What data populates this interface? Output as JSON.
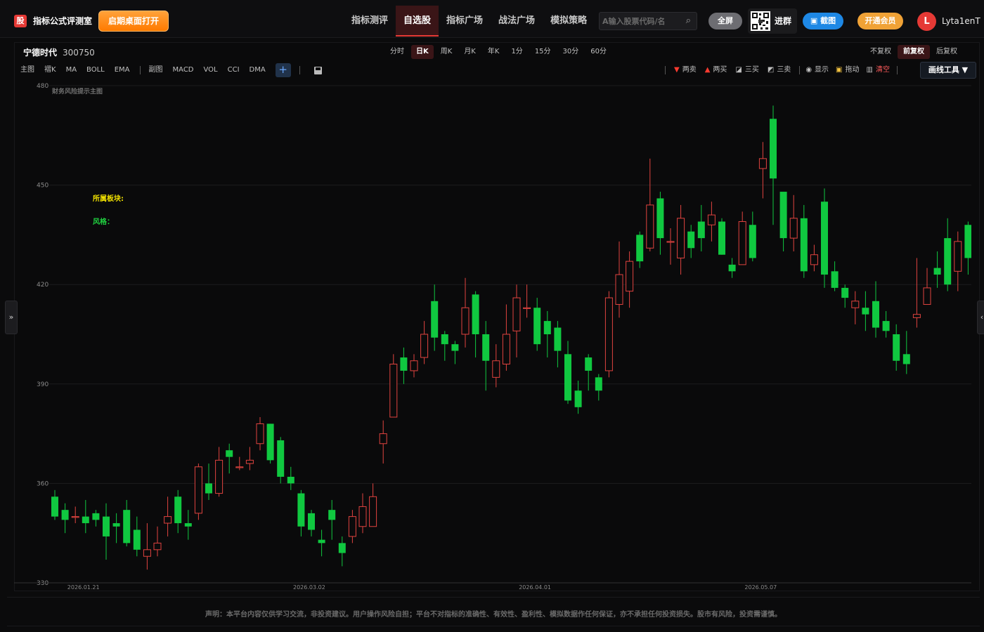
{
  "app": {
    "logo_char": "股",
    "title": "指标公式评测室",
    "open_desktop": "启期桌面打开"
  },
  "nav": {
    "items": [
      "指标测评",
      "自选股",
      "指标广场",
      "战法广场",
      "模拟策略"
    ],
    "active_index": 1
  },
  "search": {
    "placeholder": "A输入股票代码/名"
  },
  "header_actions": {
    "fullscreen": "全屏",
    "join_group": "进群",
    "screenshot": "截图",
    "vip": "开通会员",
    "avatar_letter": "L",
    "username": "Lyta1enT"
  },
  "stock": {
    "name": "宁德时代",
    "code": "300750"
  },
  "periods": {
    "items": [
      "分时",
      "日K",
      "周K",
      "月K",
      "年K",
      "1分",
      "15分",
      "30分",
      "60分"
    ],
    "active_index": 1
  },
  "adjust": {
    "items": [
      "不复权",
      "前复权",
      "后复权"
    ],
    "active_index": 1
  },
  "indicator_tools": {
    "main": [
      "主图",
      "褶K",
      "MA",
      "BOLL",
      "EMA"
    ],
    "sub": [
      "副图",
      "MACD",
      "VOL",
      "CCI",
      "DMA"
    ],
    "add": "+"
  },
  "draw_tools": {
    "items": [
      {
        "label": "两卖",
        "icon": "down-triangle-icon",
        "color": "#ff3b30"
      },
      {
        "label": "两买",
        "icon": "up-triangle-icon",
        "color": "#ff3b30"
      },
      {
        "label": "三买",
        "icon": "chart-line-icon",
        "color": "#e0e0e0"
      },
      {
        "label": "三卖",
        "icon": "chart-line-icon",
        "color": "#e0e0e0"
      },
      {
        "label": "显示",
        "icon": "eye-icon",
        "color": "#e0e0e0"
      },
      {
        "label": "拖动",
        "icon": "lock-icon",
        "color": "#e0e0e0"
      },
      {
        "label": "清空",
        "icon": "trash-icon",
        "color": "#ff5a5a"
      }
    ],
    "dropdown": "画线工具 ▼"
  },
  "side": {
    "left": "»",
    "right": "‹"
  },
  "chart_overlay": {
    "subtitle": "财务风险提示主图",
    "sector_label": "所属板块:",
    "style_label": "风格："
  },
  "colors": {
    "up": "#e0433f",
    "down": "#10c840",
    "accent": "#e53935",
    "grid": "#1c1c1e"
  },
  "chart_data": {
    "type": "candlestick",
    "ylim": [
      330,
      480
    ],
    "yticks": [
      480,
      450,
      420,
      390,
      360,
      330
    ],
    "xlabels": [
      {
        "label": "2026.01.21",
        "index": 3
      },
      {
        "label": "2026.03.02",
        "index": 25
      },
      {
        "label": "2026.04.01",
        "index": 47
      },
      {
        "label": "2026.05.07",
        "index": 69
      }
    ],
    "candles": [
      [
        356,
        350,
        358,
        349
      ],
      [
        352,
        349,
        354,
        345
      ],
      [
        350,
        350,
        353,
        348
      ],
      [
        350,
        348,
        355,
        345
      ],
      [
        351,
        349,
        352,
        347
      ],
      [
        350,
        344,
        354,
        337
      ],
      [
        348,
        347,
        351,
        342
      ],
      [
        352,
        342,
        355,
        341
      ],
      [
        346,
        340,
        350,
        338
      ],
      [
        338,
        340,
        348,
        334
      ],
      [
        340,
        342,
        347,
        338
      ],
      [
        348,
        350,
        356,
        344
      ],
      [
        356,
        348,
        358,
        345
      ],
      [
        348,
        347,
        352,
        343
      ],
      [
        351,
        365,
        366,
        349
      ],
      [
        360,
        357,
        366,
        355
      ],
      [
        357,
        367,
        371,
        356
      ],
      [
        370,
        368,
        372,
        363
      ],
      [
        365,
        365,
        368,
        364
      ],
      [
        366,
        367,
        371,
        364
      ],
      [
        372,
        378,
        380,
        370
      ],
      [
        378,
        367,
        378,
        366
      ],
      [
        373,
        362,
        374,
        360
      ],
      [
        362,
        360,
        365,
        358
      ],
      [
        357,
        347,
        358,
        344
      ],
      [
        351,
        346,
        352,
        344
      ],
      [
        343,
        342,
        346,
        338
      ],
      [
        352,
        349,
        355,
        343
      ],
      [
        342,
        339,
        344,
        335
      ],
      [
        344,
        350,
        352,
        342
      ],
      [
        347,
        353,
        357,
        345
      ],
      [
        347,
        356,
        360,
        347
      ],
      [
        372,
        375,
        379,
        366
      ],
      [
        380,
        396,
        399,
        380
      ],
      [
        398,
        394,
        401,
        390
      ],
      [
        394,
        397,
        399,
        392
      ],
      [
        398,
        405,
        409,
        396
      ],
      [
        415,
        404,
        420,
        400
      ],
      [
        405,
        402,
        406,
        397
      ],
      [
        402,
        400,
        403,
        396
      ],
      [
        405,
        413,
        422,
        401
      ],
      [
        417,
        405,
        418,
        398
      ],
      [
        405,
        397,
        409,
        388
      ],
      [
        392,
        397,
        402,
        389
      ],
      [
        396,
        405,
        414,
        394
      ],
      [
        406,
        416,
        420,
        398
      ],
      [
        413,
        413,
        420,
        410
      ],
      [
        413,
        402,
        416,
        400
      ],
      [
        409,
        405,
        412,
        398
      ],
      [
        407,
        400,
        409,
        395
      ],
      [
        399,
        385,
        403,
        384
      ],
      [
        388,
        383,
        391,
        381
      ],
      [
        398,
        394,
        399,
        388
      ],
      [
        392,
        388,
        393,
        385
      ],
      [
        394,
        416,
        418,
        392
      ],
      [
        414,
        423,
        433,
        410
      ],
      [
        418,
        427,
        430,
        413
      ],
      [
        435,
        427,
        436,
        425
      ],
      [
        431,
        444,
        458,
        430
      ],
      [
        446,
        434,
        448,
        429
      ],
      [
        433,
        433,
        437,
        426
      ],
      [
        428,
        440,
        444,
        423
      ],
      [
        436,
        431,
        438,
        428
      ],
      [
        439,
        434,
        444,
        430
      ],
      [
        438,
        441,
        445,
        433
      ],
      [
        439,
        429,
        440,
        429
      ],
      [
        426,
        424,
        428,
        422
      ],
      [
        426,
        439,
        442,
        426
      ],
      [
        438,
        428,
        442,
        427
      ],
      [
        455,
        458,
        463,
        446
      ],
      [
        470,
        452,
        474,
        438
      ],
      [
        448,
        434,
        445,
        430
      ],
      [
        434,
        440,
        447,
        430
      ],
      [
        440,
        424,
        444,
        422
      ],
      [
        426,
        429,
        432,
        424
      ],
      [
        445,
        423,
        449,
        419
      ],
      [
        424,
        419,
        427,
        418
      ],
      [
        419,
        416,
        420,
        413
      ],
      [
        413,
        415,
        418,
        408
      ],
      [
        413,
        411,
        418,
        406
      ],
      [
        415,
        407,
        421,
        404
      ],
      [
        409,
        406,
        412,
        404
      ],
      [
        405,
        397,
        408,
        394
      ],
      [
        399,
        396,
        406,
        393
      ],
      [
        410,
        411,
        428,
        407
      ],
      [
        414,
        419,
        425,
        416
      ],
      [
        425,
        423,
        430,
        419
      ],
      [
        434,
        420,
        440,
        418
      ],
      [
        424,
        433,
        436,
        418
      ],
      [
        438,
        428,
        439,
        423
      ],
      [
        428,
        419,
        428,
        418
      ]
    ]
  },
  "footer": {
    "disclaimer": "声明：本平台内容仅供学习交流，非投资建议。用户操作风险自担；平台不对指标的准确性、有效性、盈利性、模拟数据作任何保证，亦不承担任何投资损失。股市有风险，投资需谨慎。"
  }
}
